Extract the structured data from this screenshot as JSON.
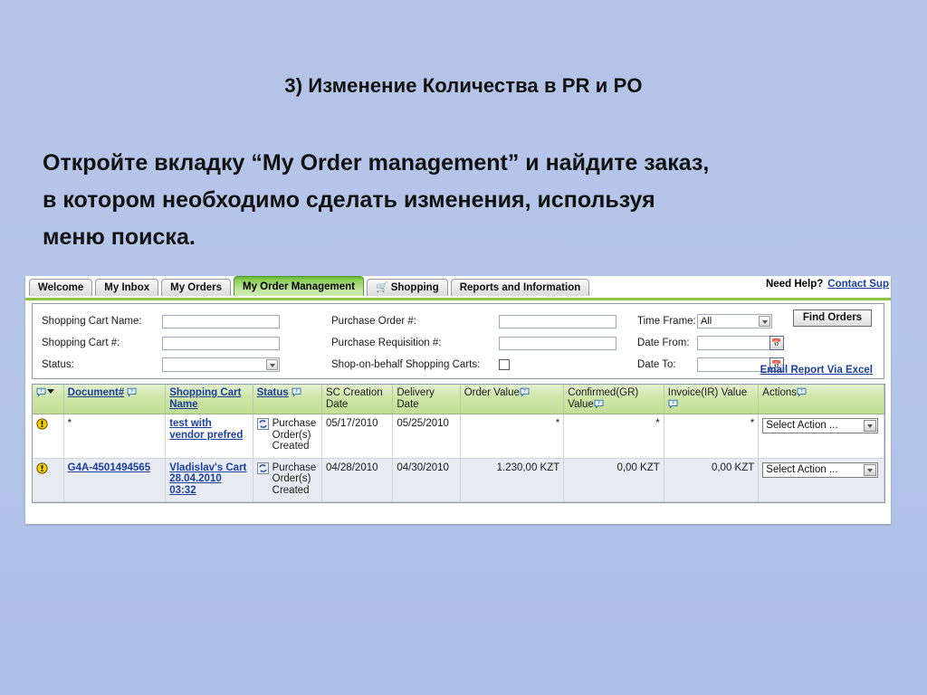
{
  "slide": {
    "title": "3) Изменение Количества в PR и PO",
    "body_lines": [
      "Откройте вкладку  “My Order management” и найдите заказ,",
      "в котором необходимо сделать изменения, используя",
      "меню поиска."
    ]
  },
  "app": {
    "tabs": [
      {
        "label": "Welcome",
        "active": false,
        "icon": ""
      },
      {
        "label": "My Inbox",
        "active": false,
        "icon": ""
      },
      {
        "label": "My Orders",
        "active": false,
        "icon": ""
      },
      {
        "label": "My Order Management",
        "active": true,
        "icon": ""
      },
      {
        "label": "Shopping",
        "active": false,
        "icon": "shopping-cart-icon"
      },
      {
        "label": "Reports and Information",
        "active": false,
        "icon": ""
      }
    ],
    "help": {
      "question": "Need Help?",
      "link": "Contact Sup"
    },
    "search_form": {
      "shopping_cart_name": {
        "label": "Shopping Cart Name:",
        "value": ""
      },
      "shopping_cart_number": {
        "label": "Shopping Cart #:",
        "value": ""
      },
      "status": {
        "label": "Status:",
        "value": ""
      },
      "purchase_order_number": {
        "label": "Purchase Order #:",
        "value": ""
      },
      "purchase_requisition_number": {
        "label": "Purchase Requisition #:",
        "value": ""
      },
      "shop_on_behalf": {
        "label": "Shop-on-behalf Shopping Carts:",
        "checked": false
      },
      "time_frame": {
        "label": "Time Frame:",
        "value": "All"
      },
      "date_from": {
        "label": "Date From:",
        "value": ""
      },
      "date_to": {
        "label": "Date To:",
        "value": ""
      },
      "find_orders_button": "Find Orders",
      "email_report_link": "Email Report Via Excel"
    },
    "table": {
      "columns": [
        {
          "key": "flag",
          "label": "",
          "link": false,
          "help": true,
          "sort": true
        },
        {
          "key": "document",
          "label": "Document#",
          "link": true,
          "help": true,
          "sort": false
        },
        {
          "key": "cartname",
          "label": "Shopping Cart Name",
          "link": true,
          "help": false,
          "sort": false
        },
        {
          "key": "status",
          "label": "Status",
          "link": true,
          "help": true,
          "sort": false
        },
        {
          "key": "sccreated",
          "label": "SC Creation Date",
          "link": false,
          "help": false,
          "sort": false
        },
        {
          "key": "delivery",
          "label": "Delivery Date",
          "link": false,
          "help": false,
          "sort": false
        },
        {
          "key": "ordval",
          "label": "Order Value",
          "link": false,
          "help": true,
          "sort": false
        },
        {
          "key": "confval",
          "label": "Confirmed(GR) Value",
          "link": false,
          "help": true,
          "sort": false
        },
        {
          "key": "invval",
          "label": "Invoice(IR) Value",
          "link": false,
          "help": true,
          "sort": false
        },
        {
          "key": "actions",
          "label": "Actions",
          "link": false,
          "help": true,
          "sort": false
        }
      ],
      "rows": [
        {
          "flag_icon": "warning-icon",
          "document": "*",
          "document_is_link": false,
          "cartname": "test with vendor prefred",
          "status": "Purchase Order(s) Created",
          "sccreated": "05/17/2010",
          "delivery": "05/25/2010",
          "ordval": "*",
          "confval": "*",
          "invval": "*",
          "action": "Select Action ..."
        },
        {
          "flag_icon": "warning-icon",
          "document": "G4A-4501494565",
          "document_is_link": true,
          "cartname": "Vladislav's Cart 28.04.2010 03:32",
          "status": "Purchase Order(s) Created",
          "sccreated": "04/28/2010",
          "delivery": "04/30/2010",
          "ordval": "1.230,00 KZT",
          "confval": "0,00 KZT",
          "invval": "0,00 KZT",
          "action": "Select Action ..."
        }
      ]
    }
  },
  "colors": {
    "slide_background": "#b3c4e8",
    "tab_active": "#8fd05c",
    "table_header": "#cfe6a8",
    "link": "#1a3fa0",
    "warning": "#f2c200"
  }
}
